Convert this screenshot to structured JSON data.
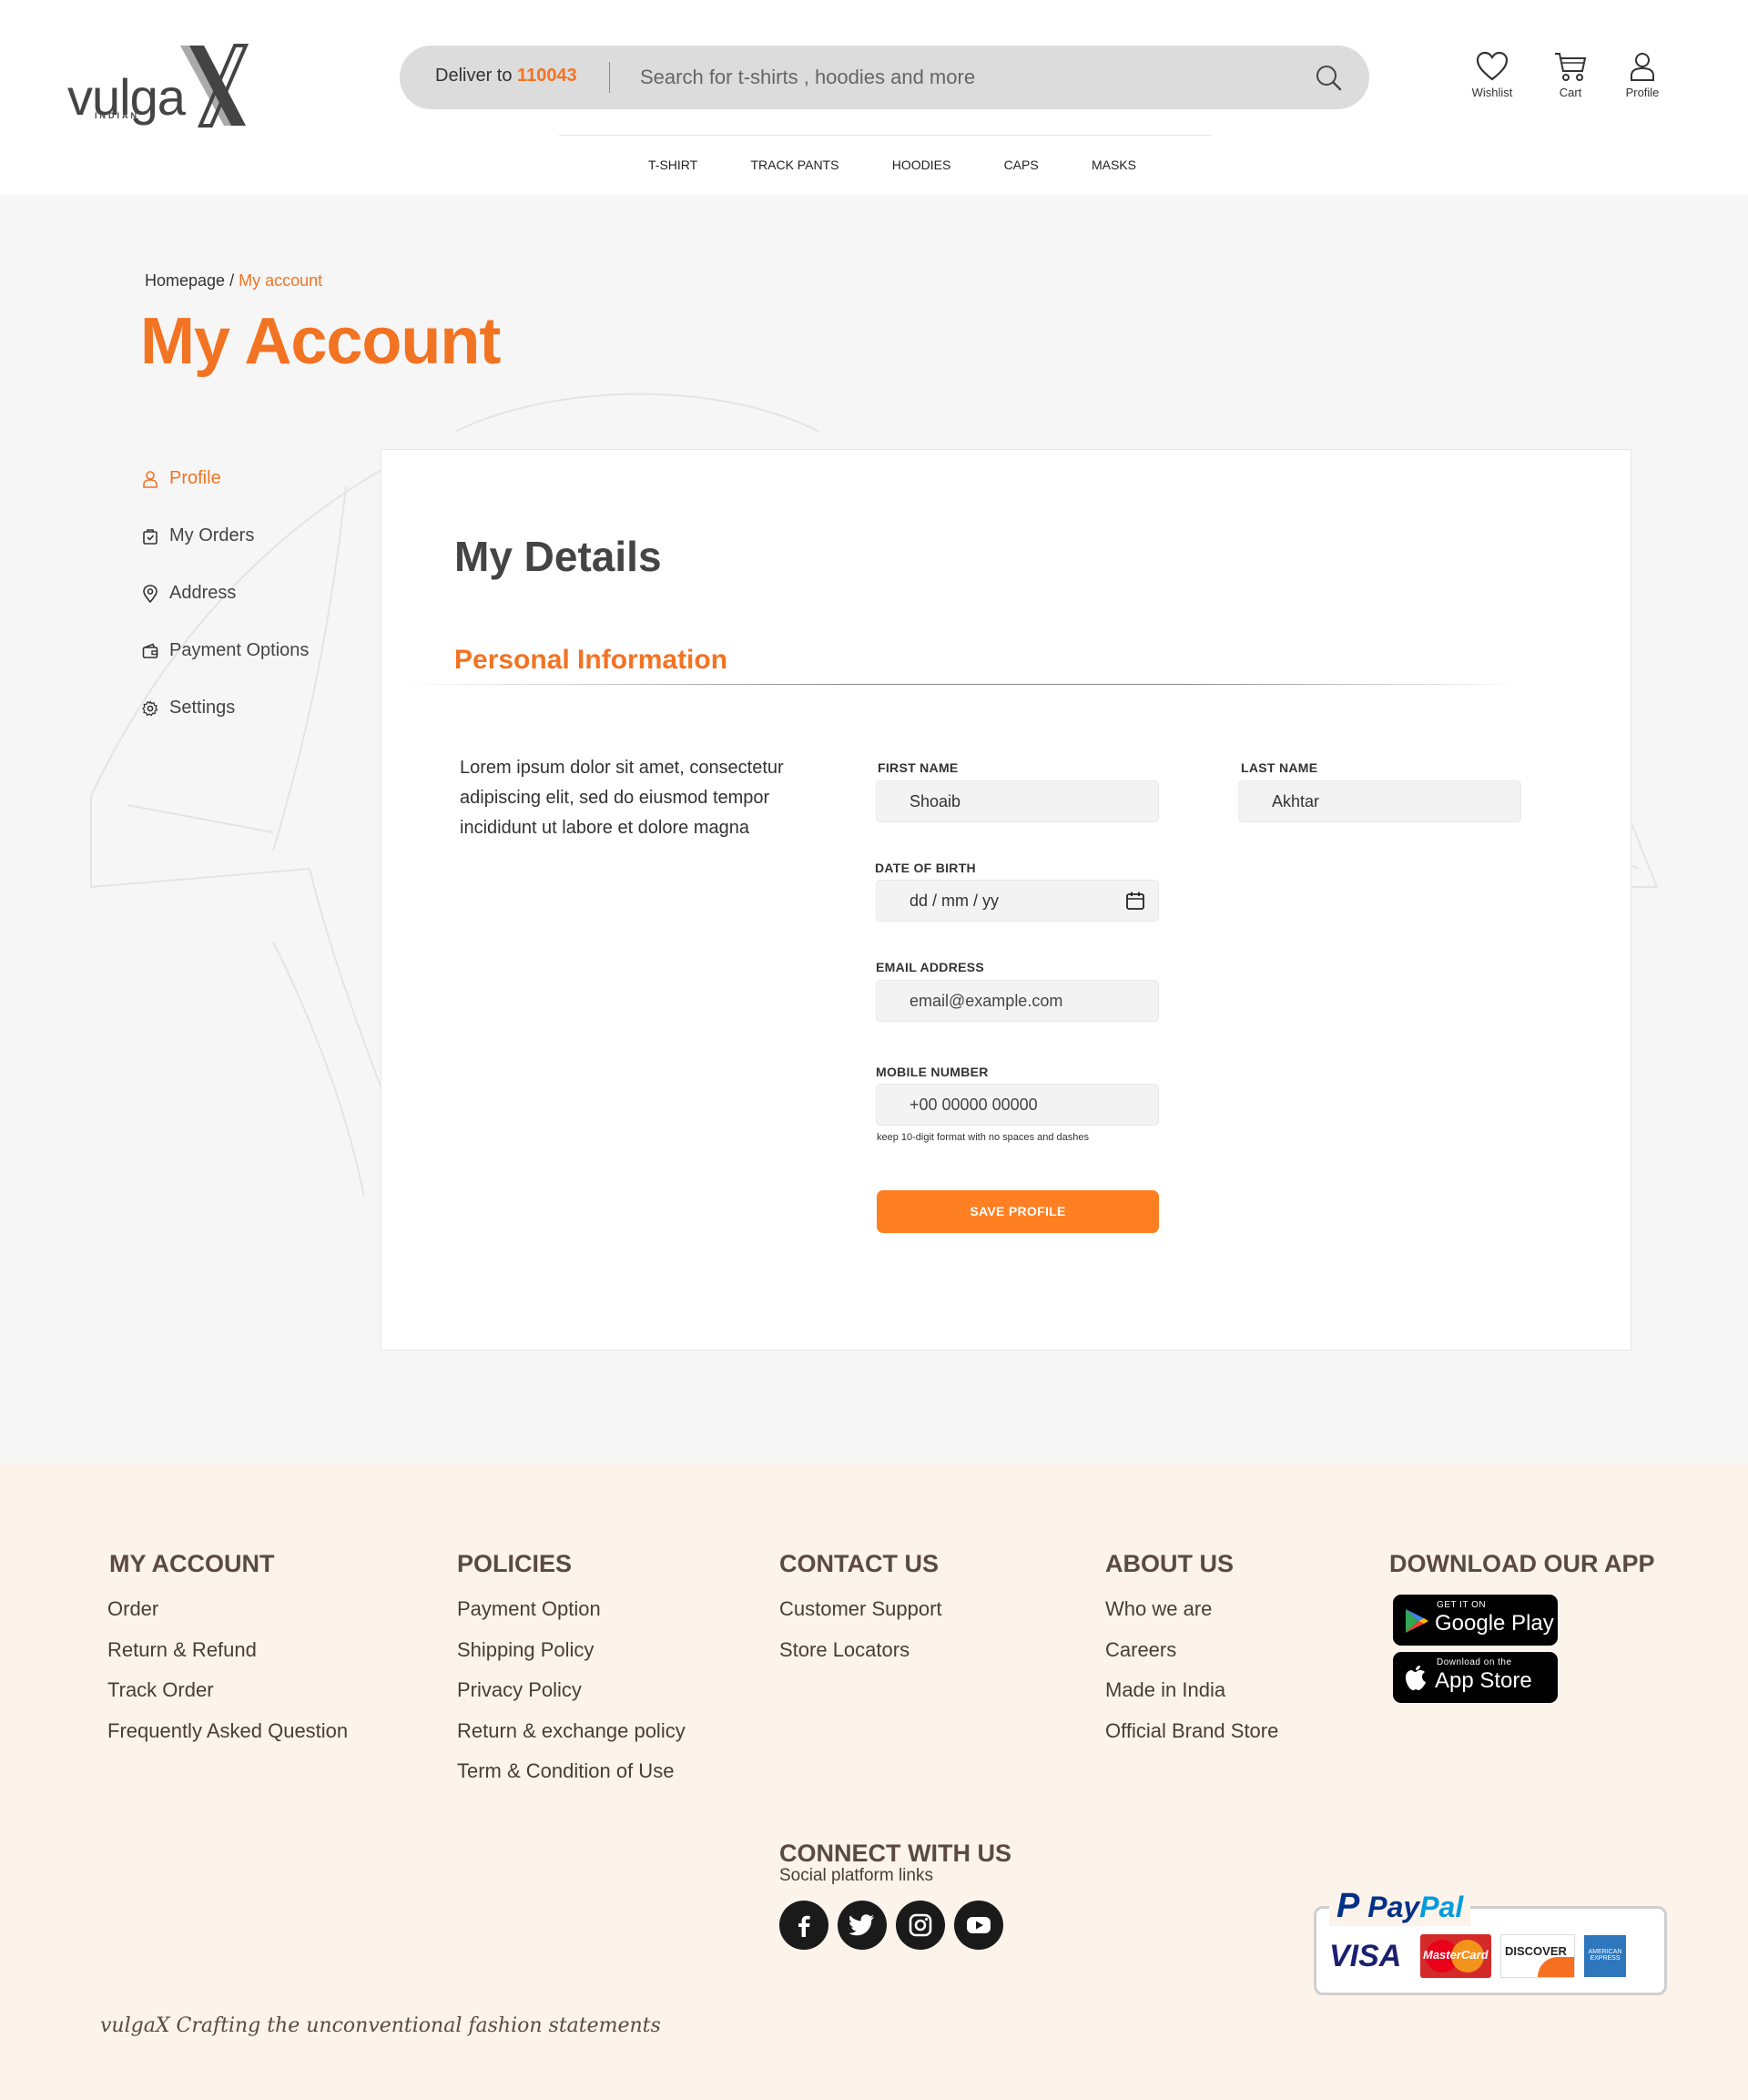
{
  "header": {
    "logo_main": "vulga",
    "logo_sub": "INDIAN",
    "deliver_label": "Deliver to",
    "deliver_pincode": "110043",
    "search_placeholder": "Search for t-shirts , hoodies and more",
    "wishlist_label": "Wishlist",
    "cart_label": "Cart",
    "profile_label": "Profile"
  },
  "nav": [
    "T-SHIRT",
    "TRACK PANTS",
    "HOODIES",
    "CAPS",
    "MASKS"
  ],
  "breadcrumb": {
    "home": "Homepage",
    "separator": " / ",
    "current": "My account"
  },
  "page_title": "My Account",
  "side_menu": [
    {
      "label": "Profile",
      "icon": "user-icon",
      "active": true
    },
    {
      "label": "My Orders",
      "icon": "bag-icon",
      "active": false
    },
    {
      "label": "Address",
      "icon": "location-pin-icon",
      "active": false
    },
    {
      "label": "Payment Options",
      "icon": "wallet-icon",
      "active": false
    },
    {
      "label": "Settings",
      "icon": "gear-icon",
      "active": false
    }
  ],
  "details": {
    "title": "My Details",
    "section_title": "Personal Information",
    "description": "Lorem ipsum dolor sit amet, consectetur adipiscing elit, sed do eiusmod tempor incididunt ut labore et dolore magna",
    "first_name_label": "FIRST NAME",
    "first_name_value": "Shoaib",
    "last_name_label": "LAST NAME",
    "last_name_value": "Akhtar",
    "dob_label": "DATE OF BIRTH",
    "dob_placeholder": "dd / mm / yy",
    "email_label": "EMAIL ADDRESS",
    "email_placeholder": "email@example.com",
    "mobile_label": "MOBILE NUMBER",
    "mobile_placeholder": "+00 00000 00000",
    "mobile_hint": "keep 10-digit format with no spaces and dashes",
    "save_label": "SAVE PROFILE"
  },
  "footer": {
    "my_account": {
      "heading": "MY ACCOUNT",
      "links": [
        "Order",
        "Return & Refund",
        "Track Order",
        "Frequently Asked Question"
      ]
    },
    "policies": {
      "heading": "POLICIES",
      "links": [
        "Payment Option",
        "Shipping Policy",
        "Privacy Policy",
        "Return & exchange policy",
        "Term & Condition of Use"
      ]
    },
    "contact": {
      "heading": "CONTACT US",
      "links": [
        "Customer Support",
        "Store Locators"
      ]
    },
    "about": {
      "heading": "ABOUT US",
      "links": [
        "Who we are",
        "Careers",
        "Made in India",
        "Official Brand Store"
      ]
    },
    "app": {
      "heading": "DOWNLOAD OUR APP",
      "google_small": "GET IT ON",
      "google_big": "Google Play",
      "apple_small": "Download on the",
      "apple_big": "App Store"
    },
    "connect": {
      "heading": "CONNECT WITH US",
      "sub": "Social platform links",
      "icons": [
        "facebook-icon",
        "twitter-icon",
        "instagram-icon",
        "youtube-icon"
      ]
    },
    "payments": {
      "paypal_p": "P",
      "paypal_pay": "Pay",
      "paypal_pal": "Pal",
      "visa": "VISA",
      "mastercard": "MasterCard",
      "discover": "DISCOVER",
      "amex": "AMERICAN EXPRESS"
    },
    "tagline": "vulgaX  Crafting the unconventional fashion statements"
  },
  "colors": {
    "accent": "#f27322",
    "button": "#ff7f22",
    "footer_bg": "#fcf3ea",
    "main_bg": "#f6f6f6"
  }
}
